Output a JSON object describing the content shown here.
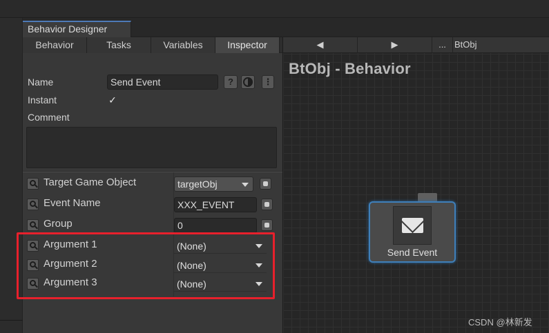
{
  "window": {
    "title": "Behavior Designer"
  },
  "tabs": [
    {
      "label": "Behavior",
      "active": false
    },
    {
      "label": "Tasks",
      "active": false
    },
    {
      "label": "Variables",
      "active": false
    },
    {
      "label": "Inspector",
      "active": true
    }
  ],
  "inspector": {
    "name_label": "Name",
    "name_value": "Send Event",
    "instant_label": "Instant",
    "instant_checked": "✓",
    "comment_label": "Comment",
    "help_btn": "?",
    "menu_btn": "⋮"
  },
  "properties": [
    {
      "label": "Target Game Object",
      "value": "targetObj",
      "kind": "select"
    },
    {
      "label": "Event Name",
      "value": "XXX_EVENT",
      "kind": "field"
    },
    {
      "label": "Group",
      "value": "0",
      "kind": "field"
    },
    {
      "label": "Argument 1",
      "value": "(None)",
      "kind": "arg"
    },
    {
      "label": "Argument 2",
      "value": "(None)",
      "kind": "arg"
    },
    {
      "label": "Argument 3",
      "value": "(None)",
      "kind": "arg"
    }
  ],
  "graph": {
    "toolbar": {
      "back": "◀",
      "forward": "▶",
      "more": "...",
      "path": "BtObj"
    },
    "title": "BtObj - Behavior",
    "node": {
      "label": "Send Event",
      "icon": "envelope-icon"
    }
  },
  "watermark": "CSDN @林新发",
  "colors": {
    "accent": "#3f7fb9",
    "highlight": "#e8202c"
  }
}
